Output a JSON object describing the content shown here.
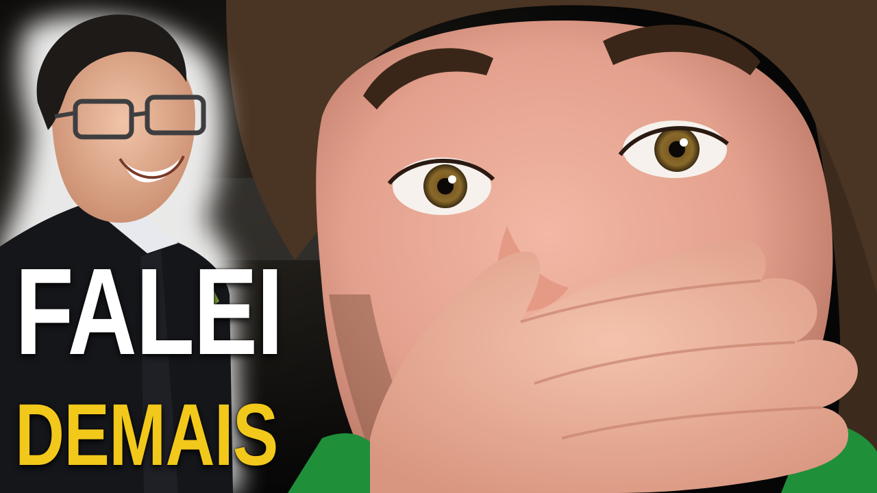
{
  "headline": {
    "line1": "FALEI",
    "line2": "DEMAIS",
    "line1_color": "#ffffff",
    "line2_color": "#f2c81b"
  },
  "image": {
    "description_icons": [
      "smiling-man-photo",
      "shocked-face-photo",
      "hand-over-mouth"
    ],
    "background_color": "#0b0b0b",
    "shirt_color": "#1f8f3a"
  }
}
